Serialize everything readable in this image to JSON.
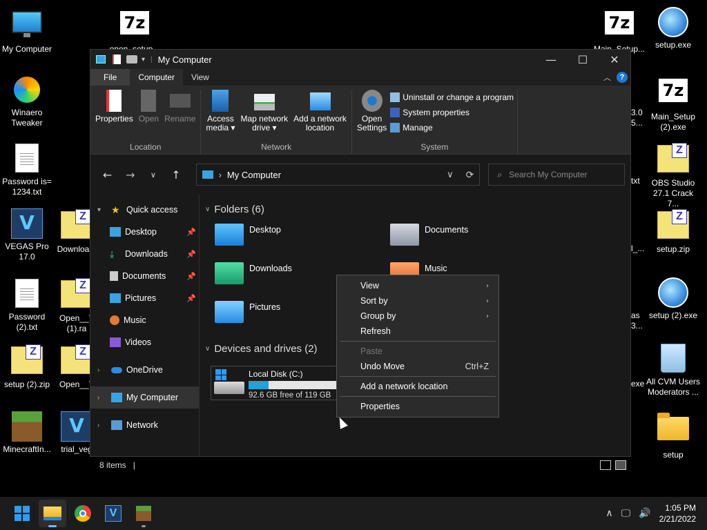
{
  "desktop": {
    "icons": [
      {
        "label": "My Computer"
      },
      {
        "label": "open_setup..."
      },
      {
        "label": "Main_Setup..."
      },
      {
        "label": "setup.exe"
      },
      {
        "label": "Winaero\nTweaker"
      },
      {
        "label": "Main_Setup\n(2).exe"
      },
      {
        "label": "Password is=\n1234.txt"
      },
      {
        "label": "OBS Studio\n27.1 Crack 7..."
      },
      {
        "label": "VEGAS Pro\n17.0"
      },
      {
        "label": "Downloa..."
      },
      {
        "label": "setup.zip"
      },
      {
        "label": "Password\n(2).txt"
      },
      {
        "label": "Open__T\n(1).ra"
      },
      {
        "label": "setup (2).exe"
      },
      {
        "label": "setup (2).zip"
      },
      {
        "label": "Open__T"
      },
      {
        "label": "All CVM Users\nModerators ..."
      },
      {
        "label": "MinecraftIn..."
      },
      {
        "label": "trial_veg"
      },
      {
        "label": "setup"
      }
    ],
    "partial_labels": [
      "3.0",
      "5...",
      "txt",
      "l_...",
      "as",
      "3...",
      "exe"
    ]
  },
  "window": {
    "title": "My Computer",
    "controls": {
      "minimize": "—",
      "maximize": "☐",
      "close": "✕"
    }
  },
  "ribbon": {
    "tabs": [
      "File",
      "Computer",
      "View"
    ],
    "groups": {
      "location": {
        "name": "Location",
        "buttons": [
          "Properties",
          "Open",
          "Rename"
        ]
      },
      "network": {
        "name": "Network",
        "buttons": [
          "Access\nmedia ▾",
          "Map network\ndrive ▾",
          "Add a network\nlocation"
        ]
      },
      "system": {
        "name": "System",
        "open_settings": "Open\nSettings",
        "small": [
          "Uninstall or change a program",
          "System properties",
          "Manage"
        ]
      }
    }
  },
  "address": {
    "path": "My Computer",
    "search_placeholder": "Search My Computer"
  },
  "nav": {
    "quick_access": "Quick access",
    "items": [
      "Desktop",
      "Downloads",
      "Documents",
      "Pictures",
      "Music",
      "Videos"
    ],
    "onedrive": "OneDrive",
    "my_computer": "My Computer",
    "network": "Network"
  },
  "content": {
    "folders_header": "Folders (6)",
    "folders": [
      "Desktop",
      "Documents",
      "Downloads",
      "Music",
      "Pictures"
    ],
    "devices_header": "Devices and drives (2)",
    "drive": {
      "name": "Local Disk (C:)",
      "free": "92.6 GB free of 119 GB",
      "used_fraction": 0.22
    }
  },
  "status": {
    "items": "8 items",
    "sep": "|"
  },
  "context_menu": {
    "items": [
      {
        "label": "View",
        "submenu": "›"
      },
      {
        "label": "Sort by",
        "submenu": "›"
      },
      {
        "label": "Group by",
        "submenu": "›"
      },
      {
        "label": "Refresh"
      },
      {
        "label": "Paste"
      },
      {
        "label": "Undo Move",
        "shortcut": "Ctrl+Z"
      },
      {
        "label": "Add a network location"
      },
      {
        "label": "Properties"
      }
    ]
  },
  "taskbar": {
    "time": "1:05 PM",
    "date": "2/21/2022"
  },
  "colors": {
    "accent": "#26a0da",
    "window_bg": "#191919",
    "ribbon_bg": "#2b2b2b"
  }
}
